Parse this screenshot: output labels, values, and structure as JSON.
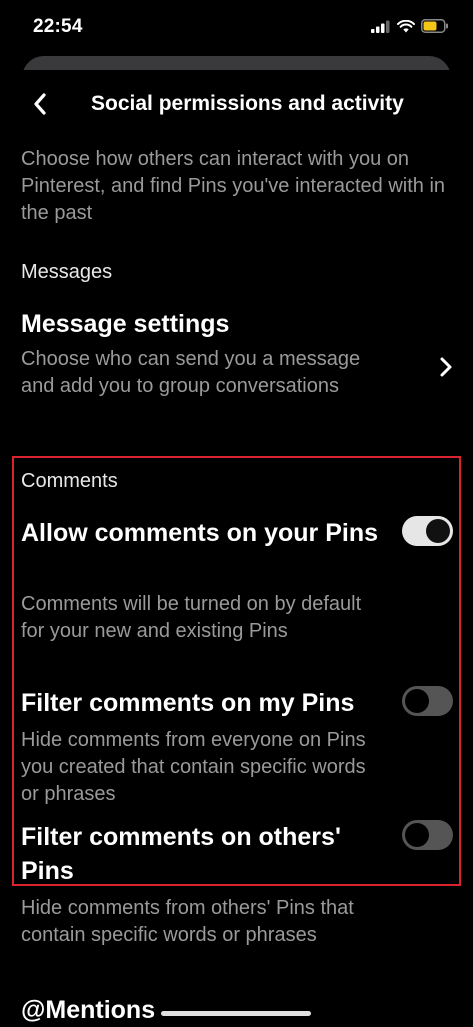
{
  "status_bar": {
    "time": "22:54",
    "icons": [
      "cellular-signal-icon",
      "wifi-icon",
      "battery-icon"
    ],
    "battery_color": "#f5c518"
  },
  "header": {
    "title": "Social permissions and activity",
    "back_icon": "chevron-left-icon"
  },
  "intro": "Choose how others can interact with you on Pinterest, and find Pins you've interacted with in the past",
  "messages": {
    "section_label": "Messages",
    "title": "Message settings",
    "description": "Choose who can send you a message and add you to group conversations",
    "chevron_icon": "chevron-right-icon"
  },
  "comments": {
    "section_label": "Comments",
    "highlight_color": "#d9232d",
    "settings": [
      {
        "title": "Allow comments on your Pins",
        "description": "Comments will be turned on by default for your new and existing Pins",
        "enabled": true
      },
      {
        "title": "Filter comments on my Pins",
        "description": "Hide comments from everyone on Pins you created that contain specific words or phrases",
        "enabled": false
      },
      {
        "title": "Filter comments on others' Pins",
        "description": "Hide comments from others' Pins that contain specific words or phrases",
        "enabled": false
      }
    ]
  },
  "mentions": {
    "section_title": "@Mentions"
  }
}
